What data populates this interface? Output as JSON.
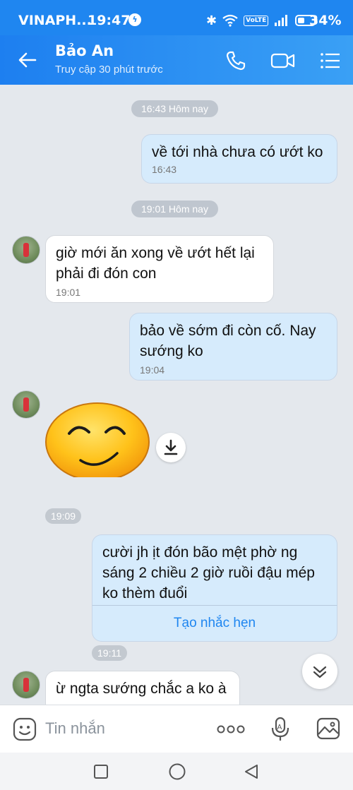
{
  "status": {
    "carrier": "VINAPH...",
    "time": "19:47",
    "network": "VoLTE",
    "battery": "34%"
  },
  "header": {
    "name": "Bảo An",
    "subtitle": "Truy cập 30 phút trước"
  },
  "messages": {
    "pill1": "16:43 Hôm nay",
    "m1": {
      "text": "về tới nhà chưa có ướt ko",
      "time": "16:43"
    },
    "pill2": "19:01 Hôm nay",
    "m2": {
      "text_line1": "giờ mới ăn xong về ướt hết lại",
      "text_line2": "phải đi đón con",
      "time": "19:01"
    },
    "m3": {
      "text_line1": "bảo về sớm đi còn cố. Nay",
      "text_line2": "sướng ko",
      "time": "19:04"
    },
    "sticker_time": "19:09",
    "m5": {
      "line1": "cười jh ịt đón bão mệt phờ ng",
      "line2": "sáng 2 chiều 2 giờ ruồi đậu mép",
      "line3": "ko thèm đuổi",
      "reminder": "Tạo nhắc hẹn",
      "time": "19:11"
    },
    "m6": {
      "text": "ừ ngta sướng chắc a ko à"
    }
  },
  "composer": {
    "placeholder": "Tin nhắn"
  },
  "colors": {
    "accent": "#1f86f0",
    "outgoing_bubble": "#d6ebfc",
    "chat_bg": "#e4e8ed"
  }
}
